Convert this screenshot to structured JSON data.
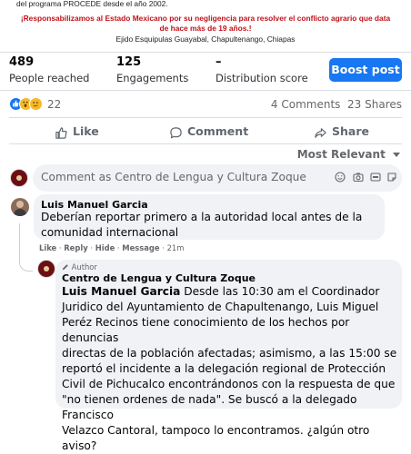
{
  "post": {
    "line1": "del programa PROCEDE desde el año 2002.",
    "line2a": "¡Responsabilizamos al Estado Mexicano por su negligencia para resolver el conflicto agrario que data",
    "line2b": "de hace más de 19 años.!",
    "line3": "Ejido Esquipulas Guayabal, Chapultenango, Chiapas"
  },
  "insights": {
    "reached_value": "489",
    "reached_label": "People reached",
    "engagements_value": "125",
    "engagements_label": "Engagements",
    "distribution_value": "–",
    "distribution_label": "Distribution score",
    "boost_label": "Boost post"
  },
  "reactions": {
    "count": "22",
    "comments_shares": "4 Comments  23 Shares",
    "emoji": [
      "like-icon",
      "wow-icon",
      "sad-icon"
    ]
  },
  "actions": {
    "like": "Like",
    "comment": "Comment",
    "share": "Share"
  },
  "sort": {
    "label": "Most Relevant"
  },
  "composer": {
    "placeholder": "Comment as Centro de Lengua y Cultura Zoque",
    "icons": [
      "emoji-icon",
      "camera-icon",
      "gif-icon",
      "sticker-icon"
    ]
  },
  "comments": [
    {
      "author": "Luis Manuel Garcia",
      "text_lines": [
        "Deberían reportar primero a la autoridad local antes de la",
        "comunidad internacional"
      ],
      "links": {
        "like": "Like",
        "reply": "Reply",
        "hide": "Hide",
        "message": "Message",
        "time": "21m"
      }
    },
    {
      "badge": "Author",
      "author": "Centro de Lengua y Cultura Zoque",
      "mention": "Luis Manuel Garcia",
      "text_lines": [
        " Desde las 10:30 am el Coordinador",
        "Juridico del Ayuntamiento de Chapultenango, Luis Miguel",
        "Peréz Recinos tiene conocimiento de los hechos por denuncias",
        "directas de la población afectadas; asimismo, a las 15:00 se",
        "reportó el incidente a la delegación regional de Protección",
        "Civil de Pichucalco encontrándonos con la respuesta de que",
        "\"no tienen ordenes de nada\". Se buscó a la delegado Francisco",
        "Velazco Cantoral, tampoco lo encontramos. ¿algún otro aviso?"
      ]
    }
  ],
  "colors": {
    "accent": "#1877f2",
    "alert_text": "#c0131b",
    "bubble": "#f0f2f5",
    "muted": "#65676b"
  }
}
